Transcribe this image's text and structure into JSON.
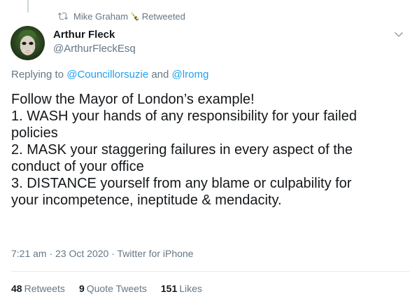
{
  "social_context": {
    "retweeter": "Mike Graham",
    "bottle_emoji": "🍾",
    "action": "Retweeted"
  },
  "author": {
    "name": "Arthur Fleck",
    "handle": "@ArthurFleckEsq"
  },
  "reply": {
    "prefix": "Replying to",
    "mention1": "@Councillorsuzie",
    "and": "and",
    "mention2": "@lromg"
  },
  "tweet": {
    "lines": [
      "Follow the Mayor of London’s example!",
      "1. WASH your hands of any responsibility for your failed",
      "policies",
      "2. MASK your staggering failures in every aspect of the",
      "conduct of your office",
      "3. DISTANCE yourself from any blame or culpability for",
      "your incompetence, ineptitude & mendacity."
    ]
  },
  "meta": {
    "time": "7:21 am",
    "sep1": "·",
    "date": "23 Oct 2020",
    "sep2": "·",
    "source": "Twitter for iPhone"
  },
  "stats": {
    "retweets_count": "48",
    "retweets_label": "Retweets",
    "quotes_count": "9",
    "quotes_label": "Quote Tweets",
    "likes_count": "151",
    "likes_label": "Likes"
  },
  "colors": {
    "link": "#1da1f2",
    "secondary": "#657786",
    "primary": "#14171a",
    "divider": "#e6ecf0"
  }
}
